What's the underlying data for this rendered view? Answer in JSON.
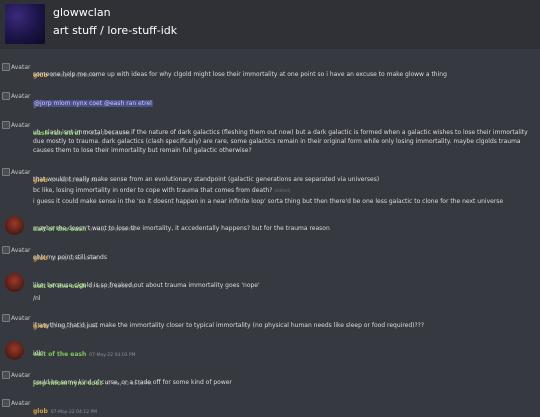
{
  "header": {
    "guild_name": "glowwclan",
    "channel_path": "art stuff / lore-stuff-idk"
  },
  "avatar_label": "Avatar",
  "messages": [
    {
      "author": "glob",
      "time": "07-May-22 03:14 PM",
      "lines": [
        "someone help me come up with ideas for why clgold might lose their immortality at one point so i have an excuse to make gloww a thing"
      ]
    },
    {
      "author": "glob",
      "time": "07-May-22 03:42 PM",
      "mention": "@jorp mlom nynx coet  @eash ran etrel"
    },
    {
      "author": "eash ran etrel",
      "time": "07-May-22 03:51 PM",
      "lines": [
        "uh- clash isnt immortal because if the nature of dark galactics (fleshing them out now)  but a dark galactic is formed when a galactic wishes to lose their immortality due mostly to trauma. dark galactics (clash specifically) are rare, some galactics remain in their original form while only losing immortality. maybe clgolds trauma causes them to lose their immortality but remain full galactic otherwise?"
      ]
    },
    {
      "author": "glob",
      "time": "07-May-22 03:59 PM",
      "lines": [
        "that wouldnt really make sense from an evolutionary standpoint (galactic generations are separated via universes)",
        "bc like, losing immortality in order to cope with trauma that comes from death?",
        "i guess it could make sense in the 'so it doesnt happen in a near infinite loop' sorta thing but then there'd be one less galactic to clone for the next universe"
      ],
      "edited": "(edited)"
    },
    {
      "author": "ealt of the eash",
      "time": "07-May-22 04:00 PM",
      "lines": [
        "maybe she doesn't want to lose the imortality, it accedentally happens? but for the trauma reason"
      ]
    },
    {
      "author": "glob",
      "time": "07-May-22 04:00 PM",
      "lines": [
        "ehh my point still stands"
      ]
    },
    {
      "author": "ealt of the eash",
      "time": "07-May-22 04:01 PM",
      "lines": [
        "like, because clgold is so freaked out about trauma immortality goes 'nope'",
        "/nl"
      ]
    },
    {
      "author": "glob",
      "time": "07-May-22 04:03 PM",
      "lines": [
        "if anything that'd just make the immortality closer to typical immortality (no physical human needs like sleep or food required)???"
      ]
    },
    {
      "author": "ealt of the eash",
      "time": "07-May-22 04:03 PM",
      "lines": [
        "idk"
      ]
    },
    {
      "author": "jorp mlom nynx coet",
      "time": "07-May-22 04:10 PM",
      "lines": [
        "could be some kind of curse, or a trade off for some kind of power"
      ]
    },
    {
      "author": "glob",
      "time": "07-May-22 04:12 PM",
      "lines": []
    }
  ]
}
